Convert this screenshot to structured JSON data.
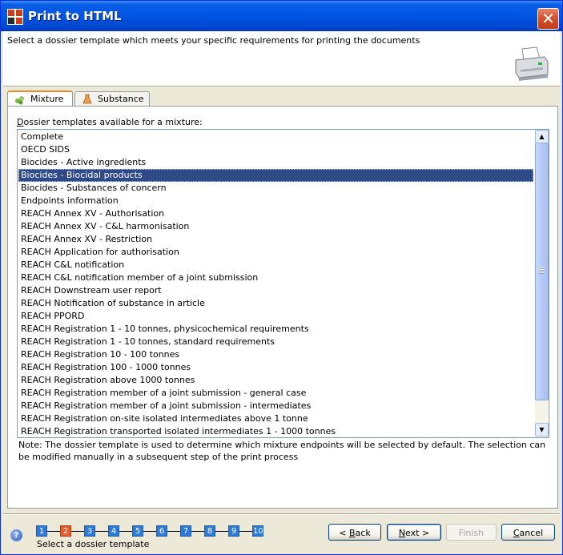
{
  "window": {
    "title": "Print to HTML"
  },
  "header": {
    "description": "Select a dossier template which meets your specific requirements for printing the documents"
  },
  "tabs": [
    {
      "label": "Mixture",
      "active": true
    },
    {
      "label": "Substance",
      "active": false
    }
  ],
  "list": {
    "label_prefix": "D",
    "label_rest": "ossier templates available for a  mixture:",
    "selected_index": 3,
    "items": [
      "Complete",
      "OECD SIDS",
      "Biocides - Active ingredients",
      "Biocides - Biocidal products",
      "Biocides - Substances of concern",
      "Endpoints information",
      "REACH Annex XV - Authorisation",
      "REACH Annex XV - C&L harmonisation",
      "REACH Annex XV - Restriction",
      "REACH Application for authorisation",
      "REACH C&L notification",
      "REACH C&L notification member of a joint submission",
      "REACH Downstream user report",
      "REACH Notification of substance in article",
      "REACH PPORD",
      "REACH Registration 1 - 10 tonnes, physicochemical requirements",
      "REACH Registration 1 - 10 tonnes, standard requirements",
      "REACH Registration 10 - 100 tonnes",
      "REACH Registration 100 - 1000 tonnes",
      "REACH Registration above 1000 tonnes",
      "REACH Registration member of a joint submission - general case",
      "REACH Registration member of a joint submission - intermediates",
      "REACH Registration on-site isolated intermediates above 1 tonne",
      "REACH Registration transported isolated intermediates 1 - 1000 tonnes"
    ]
  },
  "note": "Note: The dossier template is used to determine which mixture endpoints will be selected by default. The selection can be modified manually in a subsequent step of the print process",
  "wizard": {
    "steps": [
      "1",
      "2",
      "3",
      "4",
      "5",
      "6",
      "7",
      "8",
      "9",
      "10"
    ],
    "current_step": 2,
    "caption": "Select a dossier template"
  },
  "buttons": {
    "back": {
      "prefix": "< ",
      "mnemonic": "B",
      "rest": "ack"
    },
    "next": {
      "mnemonic": "N",
      "rest": "ext >"
    },
    "finish": {
      "label": "Finish"
    },
    "cancel": {
      "mnemonic": "C",
      "rest": "ancel"
    }
  },
  "colors": {
    "titlebar": "#0054e3",
    "selection": "#2f4a86",
    "step": "#2f7ad6",
    "step_current": "#e85b2b"
  }
}
